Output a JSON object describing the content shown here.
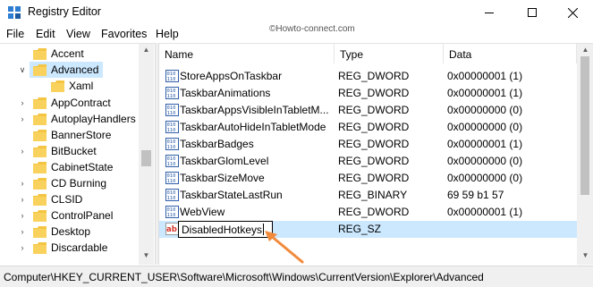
{
  "window": {
    "title": "Registry Editor",
    "watermark": "©Howto-connect.com"
  },
  "menu": [
    "File",
    "Edit",
    "View",
    "Favorites",
    "Help"
  ],
  "tree": {
    "items": [
      {
        "label": "Accent",
        "expander": "none"
      },
      {
        "label": "Advanced",
        "expander": "expanded",
        "selected": true
      },
      {
        "label": "Xaml",
        "expander": "none",
        "child": true
      },
      {
        "label": "AppContract",
        "expander": "collapsed"
      },
      {
        "label": "AutoplayHandlers",
        "expander": "collapsed"
      },
      {
        "label": "BannerStore",
        "expander": "none"
      },
      {
        "label": "BitBucket",
        "expander": "collapsed"
      },
      {
        "label": "CabinetState",
        "expander": "none"
      },
      {
        "label": "CD Burning",
        "expander": "collapsed"
      },
      {
        "label": "CLSID",
        "expander": "collapsed"
      },
      {
        "label": "ControlPanel",
        "expander": "collapsed"
      },
      {
        "label": "Desktop",
        "expander": "collapsed"
      },
      {
        "label": "Discardable",
        "expander": "collapsed"
      }
    ]
  },
  "list": {
    "headers": {
      "name": "Name",
      "type": "Type",
      "data": "Data"
    },
    "rows": [
      {
        "name": "StoreAppsOnTaskbar",
        "type": "REG_DWORD",
        "data": "0x00000001 (1)",
        "icon": "binary-value-icon"
      },
      {
        "name": "TaskbarAnimations",
        "type": "REG_DWORD",
        "data": "0x00000001 (1)",
        "icon": "binary-value-icon"
      },
      {
        "name": "TaskbarAppsVisibleInTabletM...",
        "type": "REG_DWORD",
        "data": "0x00000000 (0)",
        "icon": "binary-value-icon"
      },
      {
        "name": "TaskbarAutoHideInTabletMode",
        "type": "REG_DWORD",
        "data": "0x00000000 (0)",
        "icon": "binary-value-icon"
      },
      {
        "name": "TaskbarBadges",
        "type": "REG_DWORD",
        "data": "0x00000001 (1)",
        "icon": "binary-value-icon"
      },
      {
        "name": "TaskbarGlomLevel",
        "type": "REG_DWORD",
        "data": "0x00000000 (0)",
        "icon": "binary-value-icon"
      },
      {
        "name": "TaskbarSizeMove",
        "type": "REG_DWORD",
        "data": "0x00000000 (0)",
        "icon": "binary-value-icon"
      },
      {
        "name": "TaskbarStateLastRun",
        "type": "REG_BINARY",
        "data": "69 59 b1 57",
        "icon": "binary-value-icon"
      },
      {
        "name": "WebView",
        "type": "REG_DWORD",
        "data": "0x00000001 (1)",
        "icon": "binary-value-icon"
      }
    ],
    "editing_row": {
      "name": "DisabledHotkeys",
      "type": "REG_SZ",
      "data": "",
      "icon": "string-value-icon"
    }
  },
  "status": {
    "path": "Computer\\HKEY_CURRENT_USER\\Software\\Microsoft\\Windows\\CurrentVersion\\Explorer\\Advanced"
  },
  "colors": {
    "selection": "#cce8ff",
    "folder": "#f4c542",
    "annotation_arrow": "#f28a3c",
    "string_icon": "#d9342b",
    "binary_icon": "#2f5fa8"
  }
}
